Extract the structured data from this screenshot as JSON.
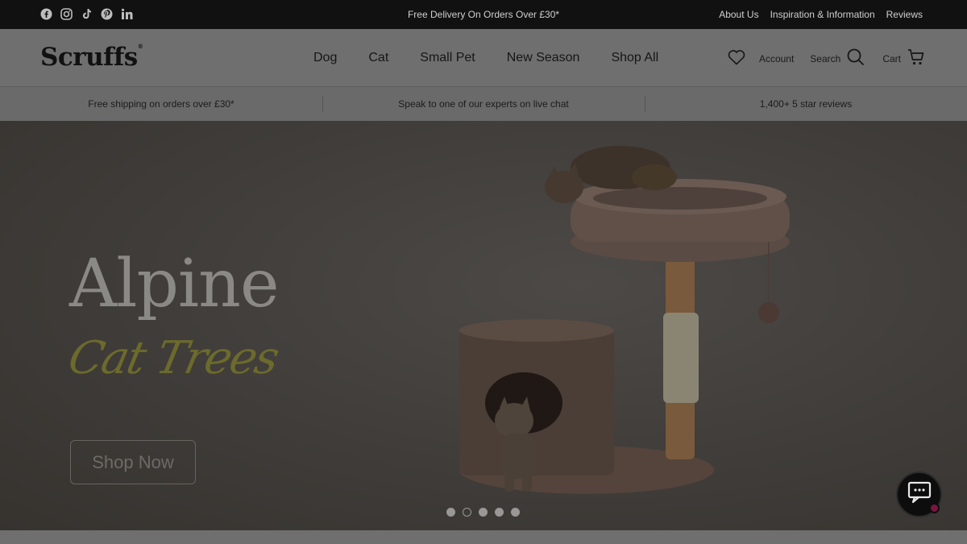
{
  "topbar": {
    "socials": [
      "facebook-icon",
      "instagram-icon",
      "tiktok-icon",
      "pinterest-icon",
      "linkedin-icon"
    ],
    "promo": "Free Delivery On Orders Over £30*",
    "links": [
      "About Us",
      "Inspiration & Information",
      "Reviews"
    ]
  },
  "header": {
    "logo": "Scruffs",
    "logo_mark": "®",
    "nav": [
      "Dog",
      "Cat",
      "Small Pet",
      "New Season",
      "Shop All"
    ],
    "account": "Account",
    "search": "Search",
    "cart": "Cart"
  },
  "usp": [
    "Free shipping on orders over £30*",
    "Speak to one of our experts on live chat",
    "1,400+ 5 star reviews"
  ],
  "hero": {
    "title": "Alpine",
    "script": "Cat Trees",
    "button": "Shop Now",
    "slide_count": 5,
    "active_slide": 2
  },
  "colors": {
    "topbar": "#111111",
    "overlay_header": "#6f6f6f",
    "hero_bg": "#3f3c39",
    "script_text": "#6c6a2c",
    "chat_badge": "#7a1542"
  }
}
